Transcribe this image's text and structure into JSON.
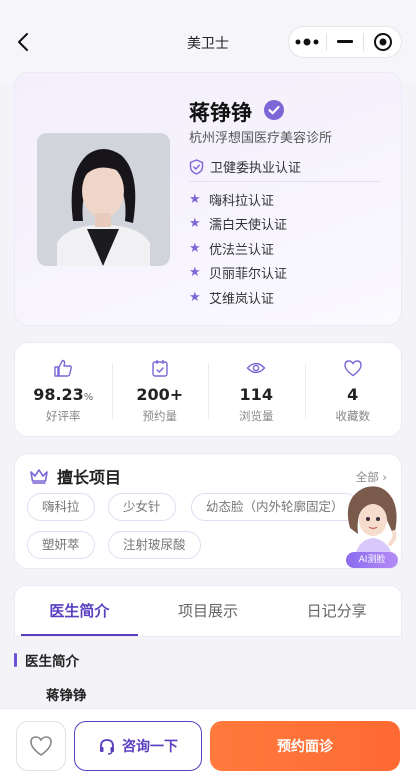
{
  "app": {
    "title": "美卫士"
  },
  "doctor": {
    "name": "蒋铮铮",
    "clinic": "杭州浮想国医疗美容诊所",
    "main_cert": "卫健委执业认证",
    "certs": [
      "嗨科拉认证",
      "濡白天使认证",
      "优法兰认证",
      "贝丽菲尔认证",
      "艾维岚认证"
    ]
  },
  "stats": [
    {
      "icon": "thumbs-up-icon",
      "value": "98.23",
      "unit": "%",
      "label": "好评率"
    },
    {
      "icon": "calendar-check-icon",
      "value": "200+",
      "unit": "",
      "label": "预约量"
    },
    {
      "icon": "eye-icon",
      "value": "114",
      "unit": "",
      "label": "浏览量"
    },
    {
      "icon": "heart-icon",
      "value": "4",
      "unit": "",
      "label": "收藏数"
    }
  ],
  "skills": {
    "title": "擅长项目",
    "all_label": "全部",
    "tags": [
      "嗨科拉",
      "少女针",
      "幼态脸（内外轮廓固定）",
      "塑妍萃",
      "注射玻尿酸"
    ]
  },
  "ai_badge": "AI测脸",
  "tabs": [
    "医生简介",
    "项目展示",
    "日记分享"
  ],
  "intro": {
    "title": "医生简介",
    "name": "蒋铮铮"
  },
  "actions": {
    "consult": "咨询一下",
    "book": "预约面诊"
  },
  "colors": {
    "accent": "#5a3fc0",
    "book": "#ff6a32"
  }
}
